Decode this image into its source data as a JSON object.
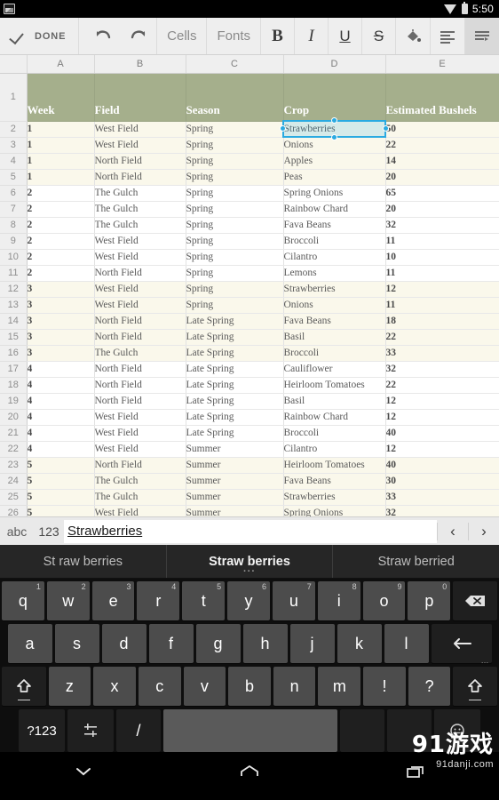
{
  "statusbar": {
    "notification_icon": "screenshot-icon",
    "wifi_icon": "wifi-icon",
    "battery_icon": "battery-icon",
    "clock": "5:50"
  },
  "toolbar": {
    "check_icon": "checkmark-icon",
    "done_label": "DONE",
    "undo_icon": "undo-icon",
    "redo_icon": "redo-icon",
    "cells_label": "Cells",
    "fonts_label": "Fonts",
    "bold_label": "B",
    "italic_label": "I",
    "underline_label": "U",
    "strikethrough_label": "S",
    "fill_icon": "paint-bucket-icon",
    "align_icon": "align-left-icon",
    "wrap_icon": "text-wrap-icon"
  },
  "grid": {
    "columns": [
      "A",
      "B",
      "C",
      "D",
      "E"
    ],
    "header_row_number": "1",
    "headers": [
      "Week",
      "Field",
      "Season",
      "Crop",
      "Estimated Bushels"
    ],
    "selected_cell": {
      "ref": "D2",
      "value": "Strawberries"
    },
    "rows": [
      {
        "n": "2",
        "band": true,
        "cells": [
          "1",
          "West Field",
          "Spring",
          "Strawberries",
          "50"
        ]
      },
      {
        "n": "3",
        "band": true,
        "cells": [
          "1",
          "West Field",
          "Spring",
          "Onions",
          "22"
        ]
      },
      {
        "n": "4",
        "band": true,
        "cells": [
          "1",
          "North Field",
          "Spring",
          "Apples",
          "14"
        ]
      },
      {
        "n": "5",
        "band": true,
        "cells": [
          "1",
          "North Field",
          "Spring",
          "Peas",
          "20"
        ]
      },
      {
        "n": "6",
        "band": false,
        "cells": [
          "2",
          "The Gulch",
          "Spring",
          "Spring Onions",
          "65"
        ]
      },
      {
        "n": "7",
        "band": false,
        "cells": [
          "2",
          "The Gulch",
          "Spring",
          "Rainbow Chard",
          "20"
        ]
      },
      {
        "n": "8",
        "band": false,
        "cells": [
          "2",
          "The Gulch",
          "Spring",
          "Fava Beans",
          "32"
        ]
      },
      {
        "n": "9",
        "band": false,
        "cells": [
          "2",
          "West Field",
          "Spring",
          "Broccoli",
          "11"
        ]
      },
      {
        "n": "10",
        "band": false,
        "cells": [
          "2",
          "West Field",
          "Spring",
          "Cilantro",
          "10"
        ]
      },
      {
        "n": "11",
        "band": false,
        "cells": [
          "2",
          "North Field",
          "Spring",
          "Lemons",
          "11"
        ]
      },
      {
        "n": "12",
        "band": true,
        "cells": [
          "3",
          "West Field",
          "Spring",
          "Strawberries",
          "12"
        ]
      },
      {
        "n": "13",
        "band": true,
        "cells": [
          "3",
          "West Field",
          "Spring",
          "Onions",
          "11"
        ]
      },
      {
        "n": "14",
        "band": true,
        "cells": [
          "3",
          "North Field",
          "Late Spring",
          "Fava Beans",
          "18"
        ]
      },
      {
        "n": "15",
        "band": true,
        "cells": [
          "3",
          "North Field",
          "Late Spring",
          "Basil",
          "22"
        ]
      },
      {
        "n": "16",
        "band": true,
        "cells": [
          "3",
          "The Gulch",
          "Late Spring",
          "Broccoli",
          "33"
        ]
      },
      {
        "n": "17",
        "band": false,
        "cells": [
          "4",
          "North Field",
          "Late Spring",
          "Cauliflower",
          "32"
        ]
      },
      {
        "n": "18",
        "band": false,
        "cells": [
          "4",
          "North Field",
          "Late Spring",
          "Heirloom Tomatoes",
          "22"
        ]
      },
      {
        "n": "19",
        "band": false,
        "cells": [
          "4",
          "North Field",
          "Late Spring",
          "Basil",
          "12"
        ]
      },
      {
        "n": "20",
        "band": false,
        "cells": [
          "4",
          "West Field",
          "Late Spring",
          "Rainbow Chard",
          "12"
        ]
      },
      {
        "n": "21",
        "band": false,
        "cells": [
          "4",
          "West Field",
          "Late Spring",
          "Broccoli",
          "40"
        ]
      },
      {
        "n": "22",
        "band": false,
        "cells": [
          "4",
          "West Field",
          "Summer",
          "Cilantro",
          "12"
        ]
      },
      {
        "n": "23",
        "band": true,
        "cells": [
          "5",
          "North Field",
          "Summer",
          "Heirloom Tomatoes",
          "40"
        ]
      },
      {
        "n": "24",
        "band": true,
        "cells": [
          "5",
          "The Gulch",
          "Summer",
          "Fava Beans",
          "30"
        ]
      },
      {
        "n": "25",
        "band": true,
        "cells": [
          "5",
          "The Gulch",
          "Summer",
          "Strawberries",
          "33"
        ]
      },
      {
        "n": "26",
        "band": true,
        "cells": [
          "5",
          "West Field",
          "Summer",
          "Spring Onions",
          "32"
        ]
      }
    ]
  },
  "formula_bar": {
    "abc_label": "abc",
    "num_label": "123",
    "value": "Strawberries",
    "prev_icon": "chevron-left-icon",
    "next_icon": "chevron-right-icon"
  },
  "suggestions": [
    {
      "text": "St raw berries",
      "selected": false
    },
    {
      "text": "Straw berries",
      "selected": true
    },
    {
      "text": "Straw berried",
      "selected": false
    }
  ],
  "keyboard": {
    "row1": [
      {
        "k": "q",
        "num": "1"
      },
      {
        "k": "w",
        "num": "2"
      },
      {
        "k": "e",
        "num": "3"
      },
      {
        "k": "r",
        "num": "4"
      },
      {
        "k": "t",
        "num": "5"
      },
      {
        "k": "y",
        "num": "6"
      },
      {
        "k": "u",
        "num": "7"
      },
      {
        "k": "i",
        "num": "8"
      },
      {
        "k": "o",
        "num": "9"
      },
      {
        "k": "p",
        "num": "0"
      }
    ],
    "backspace_icon": "backspace-icon",
    "row2": [
      "a",
      "s",
      "d",
      "f",
      "g",
      "h",
      "j",
      "k",
      "l"
    ],
    "enter_icon": "enter-arrow-icon",
    "shift_icon": "shift-up-arrow-icon",
    "row3": [
      "z",
      "x",
      "c",
      "v",
      "b",
      "n",
      "m",
      "!",
      "?"
    ],
    "sym_label": "?123",
    "settings_icon": "keyboard-settings-icon",
    "slash_label": "/",
    "space_label": "",
    "emoji_icon": "emoji-smiley-icon"
  },
  "navbar": {
    "back_icon": "keyboard-hide-chevron-icon",
    "home_icon": "home-icon",
    "recents_icon": "recent-apps-icon"
  },
  "watermark": {
    "top": "91游戏",
    "sub": "91danji.com"
  },
  "colors": {
    "header_green": "#a5af8c",
    "band_cream": "#faf8eb",
    "selection_blue": "#2aaae1",
    "toolbar_bg": "#eeeeee",
    "key_bg": "#4c4c4c"
  }
}
